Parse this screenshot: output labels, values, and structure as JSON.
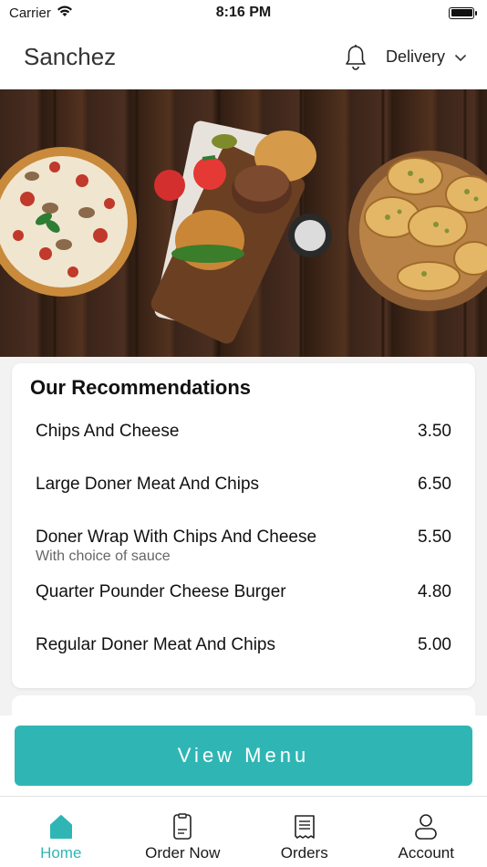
{
  "status_bar": {
    "carrier": "Carrier",
    "time": "8:16 PM"
  },
  "header": {
    "store_name": "Sanchez",
    "order_mode": "Delivery",
    "bell_icon": "bell-icon",
    "chevron_icon": "chevron-down-icon"
  },
  "hero": {
    "image_icon": "food-banner-image"
  },
  "recommendations": {
    "title": "Our Recommendations",
    "items": [
      {
        "name": "Chips And Cheese",
        "description": "",
        "price": "3.50"
      },
      {
        "name": "Large Doner Meat And Chips",
        "description": "",
        "price": "6.50"
      },
      {
        "name": "Doner Wrap With Chips And Cheese",
        "description": "With choice of sauce",
        "price": "5.50"
      },
      {
        "name": "Quarter Pounder Cheese Burger",
        "description": "",
        "price": "4.80"
      },
      {
        "name": "Regular Doner Meat And Chips",
        "description": "",
        "price": "5.00"
      }
    ]
  },
  "view_menu_label": "View Menu",
  "tabs": [
    {
      "label": "Home",
      "icon": "home-icon",
      "active": true
    },
    {
      "label": "Order Now",
      "icon": "order-now-icon",
      "active": false
    },
    {
      "label": "Orders",
      "icon": "receipt-icon",
      "active": false
    },
    {
      "label": "Account",
      "icon": "account-icon",
      "active": false
    }
  ],
  "colors": {
    "accent": "#2fb6b4",
    "text": "#1a1a1a",
    "background": "#f2f2f2"
  }
}
